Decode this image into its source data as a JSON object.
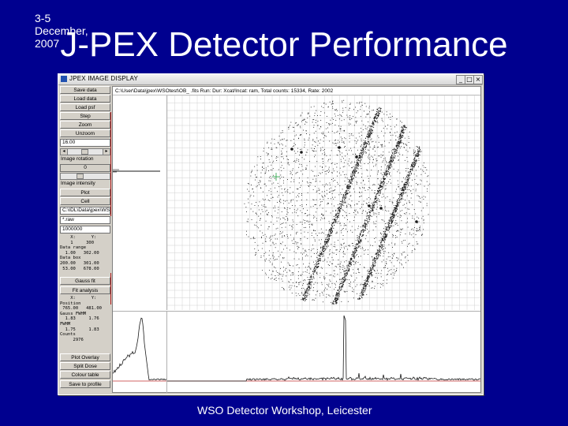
{
  "slide": {
    "title": "J-PEX Detector Performance",
    "footer_date": "3-5 December, 2007",
    "footer_event": "WSO Detector Workshop, Leicester"
  },
  "window": {
    "title": "JPEX IMAGE DISPLAY",
    "controls": [
      "_",
      "□",
      "×"
    ],
    "path": "C:\\User\\Data\\jpex\\WSOtest\\OB_ .fits  Run: Dur: Xcat/Incat: ram,  Total counts: 15334,  Rate: 2002"
  },
  "left_panel": {
    "buttons_top": [
      "Save data",
      "Load data",
      "Load psf",
      "Step",
      "Zoom",
      "Unzoom"
    ],
    "zoom_value": "16.00",
    "image_rotation_label": "Image rotation",
    "rotation_value": "0",
    "image_intensity_label": "Image intensity",
    "buttons_mid": [
      "Plot",
      "Cell"
    ],
    "path_field": "C:\\IDL\\Data\\jpex\\WSO\\fi",
    "filter_field": "*.raw",
    "count_field": "1000000",
    "coords_block": "    X:      Y:\n    1     300\nData range\n  1.00   302.00\nData box\n200.00   301.00\n 53.00   678.00",
    "buttons_fit": [
      "Gauss fit",
      "Fit analysis"
    ],
    "fit_block": "    X:      Y:\nPosition\n 765.00   481.00\nGauss FWHM\n  1.83     1.76\nFWHM\n  1.75     1.83\nCounts\n     2976",
    "buttons_bottom": [
      "Plot Overlay",
      "Split Dose",
      "Colour table",
      "Save to profile"
    ]
  },
  "colors": {
    "slide_background": "#00008f",
    "window_face": "#d4d0c8",
    "grid": "#d0d0d0",
    "events": "#1a1a1a",
    "marker": "#20a040",
    "baseline": "#c03030"
  },
  "icons": {
    "window_icon": "app-icon",
    "crosshair": "crosshair-marker-icon"
  }
}
